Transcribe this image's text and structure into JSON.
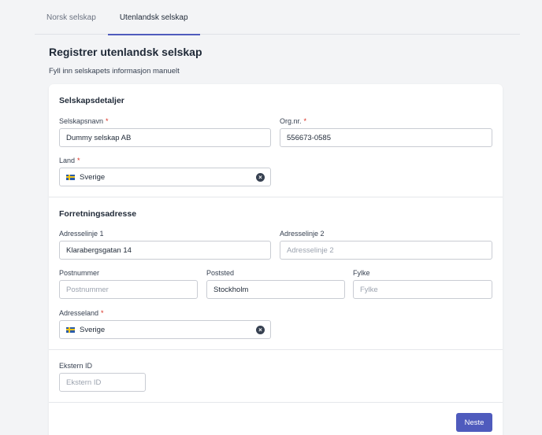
{
  "tabs": [
    {
      "label": "Norsk selskap",
      "active": false
    },
    {
      "label": "Utenlandsk selskap",
      "active": true
    }
  ],
  "page": {
    "title": "Registrer utenlandsk selskap",
    "subtitle": "Fyll inn selskapets informasjon manuelt"
  },
  "company": {
    "section_title": "Selskapsdetaljer",
    "name_label": "Selskapsnavn",
    "name_value": "Dummy selskap AB",
    "orgnr_label": "Org.nr.",
    "orgnr_value": "556673-0585",
    "country_label": "Land",
    "country_value": "Sverige",
    "country_flag": "sweden-flag-icon",
    "required_marker": "*"
  },
  "address": {
    "section_title": "Forretningsadresse",
    "line1_label": "Adresselinje 1",
    "line1_value": "Klarabergsgatan 14",
    "line2_label": "Adresselinje 2",
    "line2_placeholder": "Adresselinje 2",
    "postnr_label": "Postnummer",
    "postnr_placeholder": "Postnummer",
    "poststed_label": "Poststed",
    "poststed_value": "Stockholm",
    "fylke_label": "Fylke",
    "fylke_placeholder": "Fylke",
    "country_label": "Adresseland",
    "country_value": "Sverige",
    "country_flag": "sweden-flag-icon"
  },
  "external": {
    "label": "Ekstern ID",
    "placeholder": "Ekstern ID"
  },
  "actions": {
    "next_label": "Neste"
  },
  "colors": {
    "accent": "#4f5bbd",
    "required": "#d92d20"
  }
}
